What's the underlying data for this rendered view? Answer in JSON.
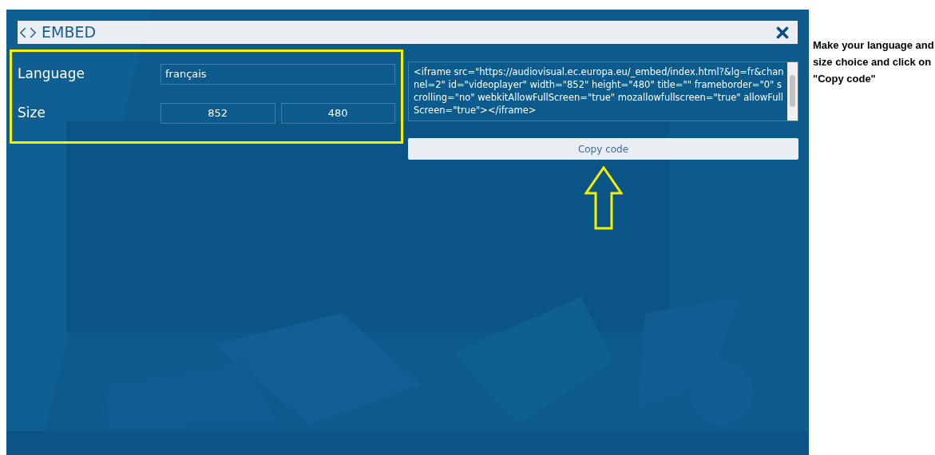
{
  "dialog": {
    "title": "EMBED",
    "fields": [
      {
        "label": "Language",
        "values": [
          "français"
        ]
      },
      {
        "label": "Size",
        "values": [
          "852",
          "480"
        ]
      }
    ],
    "code": "<iframe src=\"https://audiovisual.ec.europa.eu/_embed/index.html?&lg=fr&channel=2\" id=\"videoplayer\" width=\"852\" height=\"480\" title=\"\" frameborder=\"0\" scrolling=\"no\" webkitAllowFullScreen=\"true\" mozallowfullscreen=\"true\" allowFullScreen=\"true\"></iframe>",
    "button": "Copy code"
  },
  "note": "Make your language and size choice and click on \"Copy code\""
}
